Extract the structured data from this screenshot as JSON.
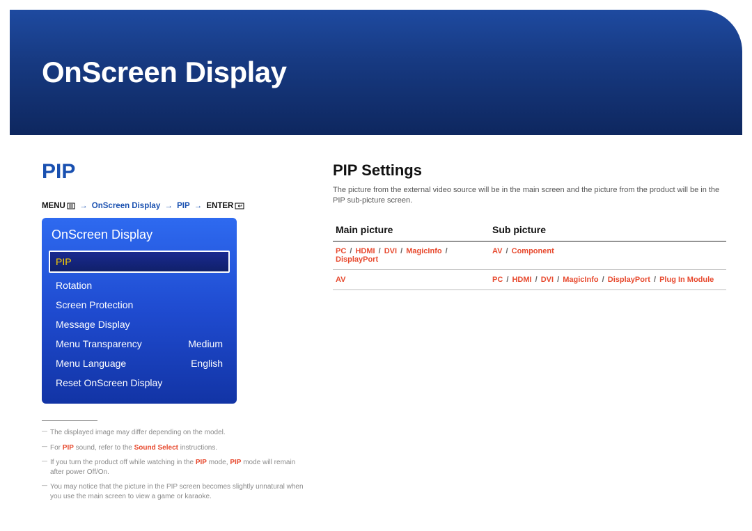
{
  "banner": {
    "title": "OnScreen Display"
  },
  "section": "PIP",
  "breadcrumb": {
    "menu": "MENU",
    "arrow": "→",
    "p1": "OnScreen Display",
    "p2": "PIP",
    "enter": "ENTER"
  },
  "osd": {
    "title": "OnScreen Display",
    "items": [
      {
        "label": "PIP",
        "value": "",
        "selected": true
      },
      {
        "label": "Rotation",
        "value": ""
      },
      {
        "label": "Screen Protection",
        "value": ""
      },
      {
        "label": "Message Display",
        "value": ""
      },
      {
        "label": "Menu Transparency",
        "value": "Medium"
      },
      {
        "label": "Menu Language",
        "value": "English"
      },
      {
        "label": "Reset OnScreen Display",
        "value": ""
      }
    ]
  },
  "footnotes": {
    "n1a": "The displayed image may differ depending on the model.",
    "n2a": "For ",
    "n2b": "PIP",
    "n2c": " sound, refer to the ",
    "n2d": "Sound Select",
    "n2e": " instructions.",
    "n3a": "If you turn the product off while watching in the ",
    "n3b": "PIP",
    "n3c": " mode, ",
    "n3d": "PIP",
    "n3e": " mode will remain after power Off/On.",
    "n4a": "You may notice that the picture in the PIP screen becomes slightly unnatural when you use the main screen to view a game or karaoke."
  },
  "right": {
    "title": "PIP Settings",
    "desc": "The picture from the external video source will be in the main screen and the picture from the product will be in the PIP sub-picture screen."
  },
  "table": {
    "h1": "Main picture",
    "h2": "Sub picture",
    "rows": [
      {
        "c1": [
          "PC",
          "HDMI",
          "DVI",
          "MagicInfo",
          "DisplayPort"
        ],
        "c2": [
          "AV",
          "Component"
        ]
      },
      {
        "c1": [
          "AV"
        ],
        "c2": [
          "PC",
          "HDMI",
          "DVI",
          "MagicInfo",
          "DisplayPort",
          "Plug In Module"
        ]
      }
    ]
  }
}
